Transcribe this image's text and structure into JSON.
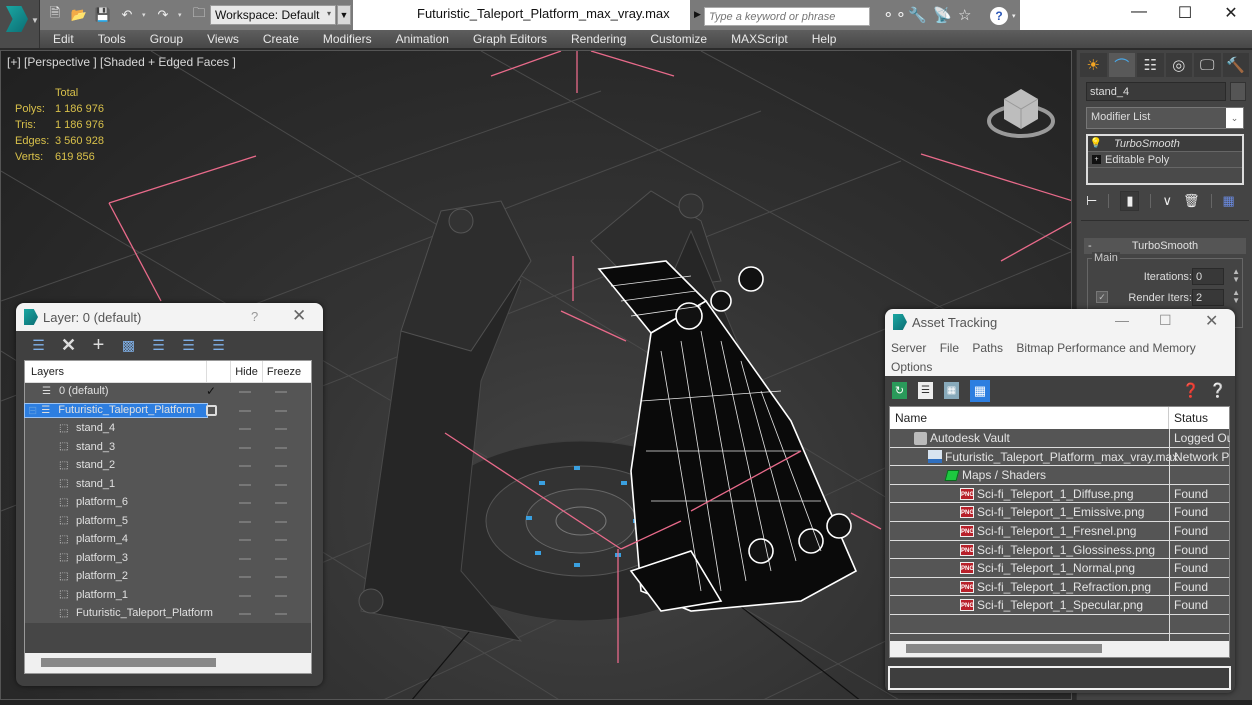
{
  "window": {
    "title": "Futuristic_Taleport_Platform_max_vray.max",
    "workspace": "Workspace: Default",
    "search_placeholder": "Type a keyword or phrase",
    "controls": [
      "minimize",
      "maximize",
      "close"
    ]
  },
  "quick_access": {
    "icons": [
      "new-file-icon",
      "open-folder-icon",
      "save-icon",
      "undo-icon",
      "redo-icon",
      "project-folder-icon"
    ]
  },
  "infocenter": {
    "icons": [
      "binoculars-icon",
      "wrench-icon",
      "satellite-icon",
      "star-icon",
      "help-icon"
    ],
    "help_glyph": "?"
  },
  "menu": {
    "items": [
      "Edit",
      "Tools",
      "Group",
      "Views",
      "Create",
      "Modifiers",
      "Animation",
      "Graph Editors",
      "Rendering",
      "Customize",
      "MAXScript",
      "Help"
    ]
  },
  "viewport": {
    "label": "[+] [Perspective ] [Shaded + Edged Faces ]",
    "stats": {
      "header": "Total",
      "rows": [
        {
          "label": "Polys:",
          "value": "1 186 976"
        },
        {
          "label": "Tris:",
          "value": "1 186 976"
        },
        {
          "label": "Edges:",
          "value": "3 560 928"
        },
        {
          "label": "Verts:",
          "value": "619 856"
        }
      ]
    }
  },
  "command_panel": {
    "tabs": [
      "create-tab",
      "modify-tab",
      "hierarchy-tab",
      "motion-tab",
      "display-tab",
      "utilities-tab"
    ],
    "object_name": "stand_4",
    "modifier_list": "Modifier List",
    "stack": [
      {
        "label": "TurboSmooth",
        "icon": "bulb-icon",
        "selected": true
      },
      {
        "label": "Editable Poly",
        "icon": "expand-icon",
        "selected": false
      }
    ],
    "rollout": {
      "title": "TurboSmooth",
      "group": "Main",
      "iterations_label": "Iterations:",
      "iterations": "0",
      "render_iters_label": "Render Iters:",
      "render_iters": "2",
      "render_iters_checked": true
    }
  },
  "layer_dialog": {
    "title": "Layer: 0 (default)",
    "help": "?",
    "toolbar": [
      "create-layer-icon",
      "delete-layer-icon",
      "add-to-layer-icon",
      "select-objects-icon",
      "select-layer-icon",
      "highlight-layer-icon",
      "layer-settings-icon"
    ],
    "columns": [
      "Layers",
      "",
      "Hide",
      "Freeze"
    ],
    "rows": [
      {
        "name": "0 (default)",
        "type": "layer",
        "indent": 1,
        "current": true
      },
      {
        "name": "Futuristic_Taleport_Platform",
        "type": "layer",
        "indent": 0,
        "selected": true
      },
      {
        "name": "stand_4",
        "type": "object",
        "indent": 2
      },
      {
        "name": "stand_3",
        "type": "object",
        "indent": 2
      },
      {
        "name": "stand_2",
        "type": "object",
        "indent": 2
      },
      {
        "name": "stand_1",
        "type": "object",
        "indent": 2
      },
      {
        "name": "platform_6",
        "type": "object",
        "indent": 2
      },
      {
        "name": "platform_5",
        "type": "object",
        "indent": 2
      },
      {
        "name": "platform_4",
        "type": "object",
        "indent": 2
      },
      {
        "name": "platform_3",
        "type": "object",
        "indent": 2
      },
      {
        "name": "platform_2",
        "type": "object",
        "indent": 2
      },
      {
        "name": "platform_1",
        "type": "object",
        "indent": 2
      },
      {
        "name": "Futuristic_Taleport_Platform",
        "type": "object",
        "indent": 2
      }
    ]
  },
  "asset_tracking": {
    "title": "Asset Tracking",
    "menu": [
      "Server",
      "File",
      "Paths",
      "Bitmap Performance and Memory",
      "Options"
    ],
    "toolbar": [
      "refresh-icon",
      "list-icon",
      "thumbnail-icon",
      "table-view-icon"
    ],
    "columns": [
      "Name",
      "Status"
    ],
    "rows": [
      {
        "name": "Autodesk Vault",
        "status": "Logged Ou",
        "icon": "vault",
        "indent": 1
      },
      {
        "name": "Futuristic_Taleport_Platform_max_vray.max",
        "status": "Network Pa",
        "icon": "max",
        "indent": 2
      },
      {
        "name": "Maps / Shaders",
        "status": "",
        "icon": "maps",
        "indent": 3
      },
      {
        "name": "Sci-fi_Teleport_1_Diffuse.png",
        "status": "Found",
        "icon": "png",
        "indent": 4
      },
      {
        "name": "Sci-fi_Teleport_1_Emissive.png",
        "status": "Found",
        "icon": "png",
        "indent": 4
      },
      {
        "name": "Sci-fi_Teleport_1_Fresnel.png",
        "status": "Found",
        "icon": "png",
        "indent": 4
      },
      {
        "name": "Sci-fi_Teleport_1_Glossiness.png",
        "status": "Found",
        "icon": "png",
        "indent": 4
      },
      {
        "name": "Sci-fi_Teleport_1_Normal.png",
        "status": "Found",
        "icon": "png",
        "indent": 4
      },
      {
        "name": "Sci-fi_Teleport_1_Refraction.png",
        "status": "Found",
        "icon": "png",
        "indent": 4
      },
      {
        "name": "Sci-fi_Teleport_1_Specular.png",
        "status": "Found",
        "icon": "png",
        "indent": 4
      }
    ],
    "png_badge": "PNG",
    "path_field": ""
  },
  "colors": {
    "accent_blue": "#2d7ee0",
    "stats_yellow": "#d8c04a",
    "bbox_pink": "#e86a8a",
    "png_red": "#b8202a",
    "brand_teal": "#1aa7a2"
  }
}
